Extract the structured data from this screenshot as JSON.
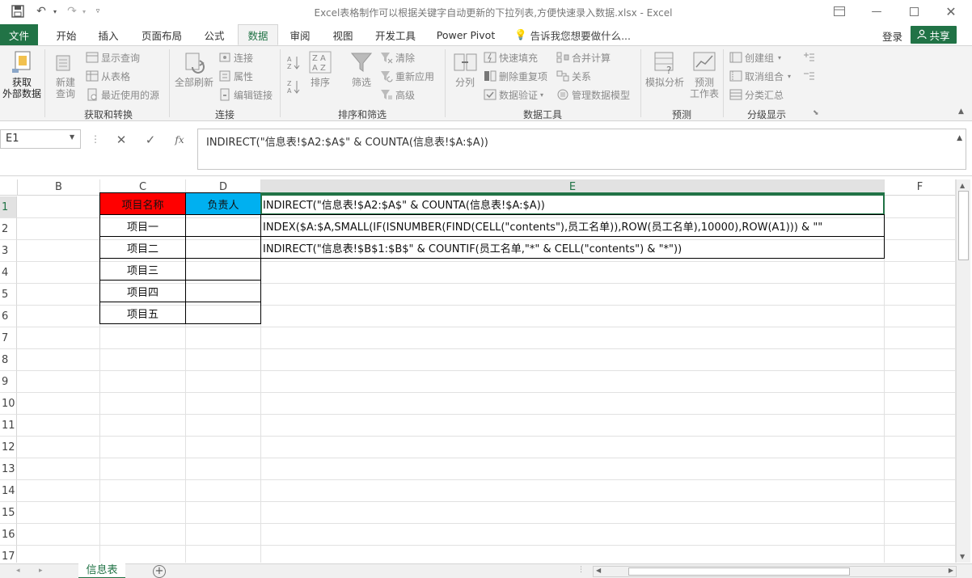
{
  "window": {
    "title": "Excel表格制作可以根据关键字自动更新的下拉列表,方便快速录入数据.xlsx - Excel"
  },
  "quick_access": {
    "save_icon": "save-icon",
    "undo_icon": "undo-icon",
    "redo_icon": "redo-icon",
    "customize_icon": "customize-qat-icon"
  },
  "tabs": [
    {
      "label": "文件"
    },
    {
      "label": "开始"
    },
    {
      "label": "插入"
    },
    {
      "label": "页面布局"
    },
    {
      "label": "公式"
    },
    {
      "label": "数据"
    },
    {
      "label": "审阅"
    },
    {
      "label": "视图"
    },
    {
      "label": "开发工具"
    },
    {
      "label": "Power Pivot"
    }
  ],
  "tell_me": "告诉我您想要做什么...",
  "account": {
    "login": "登录",
    "share": "共享"
  },
  "ribbon": {
    "get_external": "获取\n外部数据",
    "new_query": "新建\n查询",
    "show_queries": "显示查询",
    "from_table": "从表格",
    "recent_sources": "最近使用的源",
    "group_get_transform": "获取和转换",
    "refresh_all": "全部刷新",
    "connections": "连接",
    "properties": "属性",
    "edit_links": "编辑链接",
    "group_connections": "连接",
    "sort_label": "排序",
    "filter_label": "筛选",
    "clear": "清除",
    "reapply": "重新应用",
    "advanced": "高级",
    "group_sort_filter": "排序和筛选",
    "text_to_columns": "分列",
    "flash_fill": "快速填充",
    "remove_duplicates": "删除重复项",
    "data_validation": "数据验证",
    "consolidate": "合并计算",
    "relationships": "关系",
    "manage_data_model": "管理数据模型",
    "group_data_tools": "数据工具",
    "what_if": "模拟分析",
    "forecast_sheet": "预测\n工作表",
    "group_forecast": "预测",
    "group_create": "创建组",
    "ungroup": "取消组合",
    "subtotal": "分类汇总",
    "group_outline": "分级显示"
  },
  "formula_bar": {
    "name_box": "E1",
    "cancel_icon": "cancel-icon",
    "enter_icon": "enter-icon",
    "fx": "fx",
    "formula": "INDIRECT(\"信息表!$A2:$A$\" & COUNTA(信息表!$A:$A))"
  },
  "columns": [
    "B",
    "C",
    "D",
    "E",
    "F"
  ],
  "rows": [
    "1",
    "2",
    "3",
    "4",
    "5",
    "6",
    "7",
    "8",
    "9",
    "10",
    "11",
    "12",
    "13",
    "14",
    "15",
    "16",
    "17"
  ],
  "cells": {
    "C1": "项目名称",
    "D1": "负责人",
    "E1": "INDIRECT(\"信息表!$A2:$A$\" & COUNTA(信息表!$A:$A))",
    "C2": "项目一",
    "E2": "INDEX($A:$A,SMALL(IF(ISNUMBER(FIND(CELL(\"contents\"),员工名单)),ROW(员工名单),10000),ROW(A1))) & \"\"",
    "C3": "项目二",
    "E3": "INDIRECT(\"信息表!$B$1:$B$\" & COUNTIF(员工名单,\"*\" & CELL(\"contents\") & \"*\"))",
    "C4": "项目三",
    "C5": "项目四",
    "C6": "项目五"
  },
  "colors": {
    "excel_green": "#217346",
    "header_red": "#ff0000",
    "header_blue": "#00b0f0"
  },
  "sheets": [
    {
      "label": "信息表",
      "active": true
    }
  ]
}
